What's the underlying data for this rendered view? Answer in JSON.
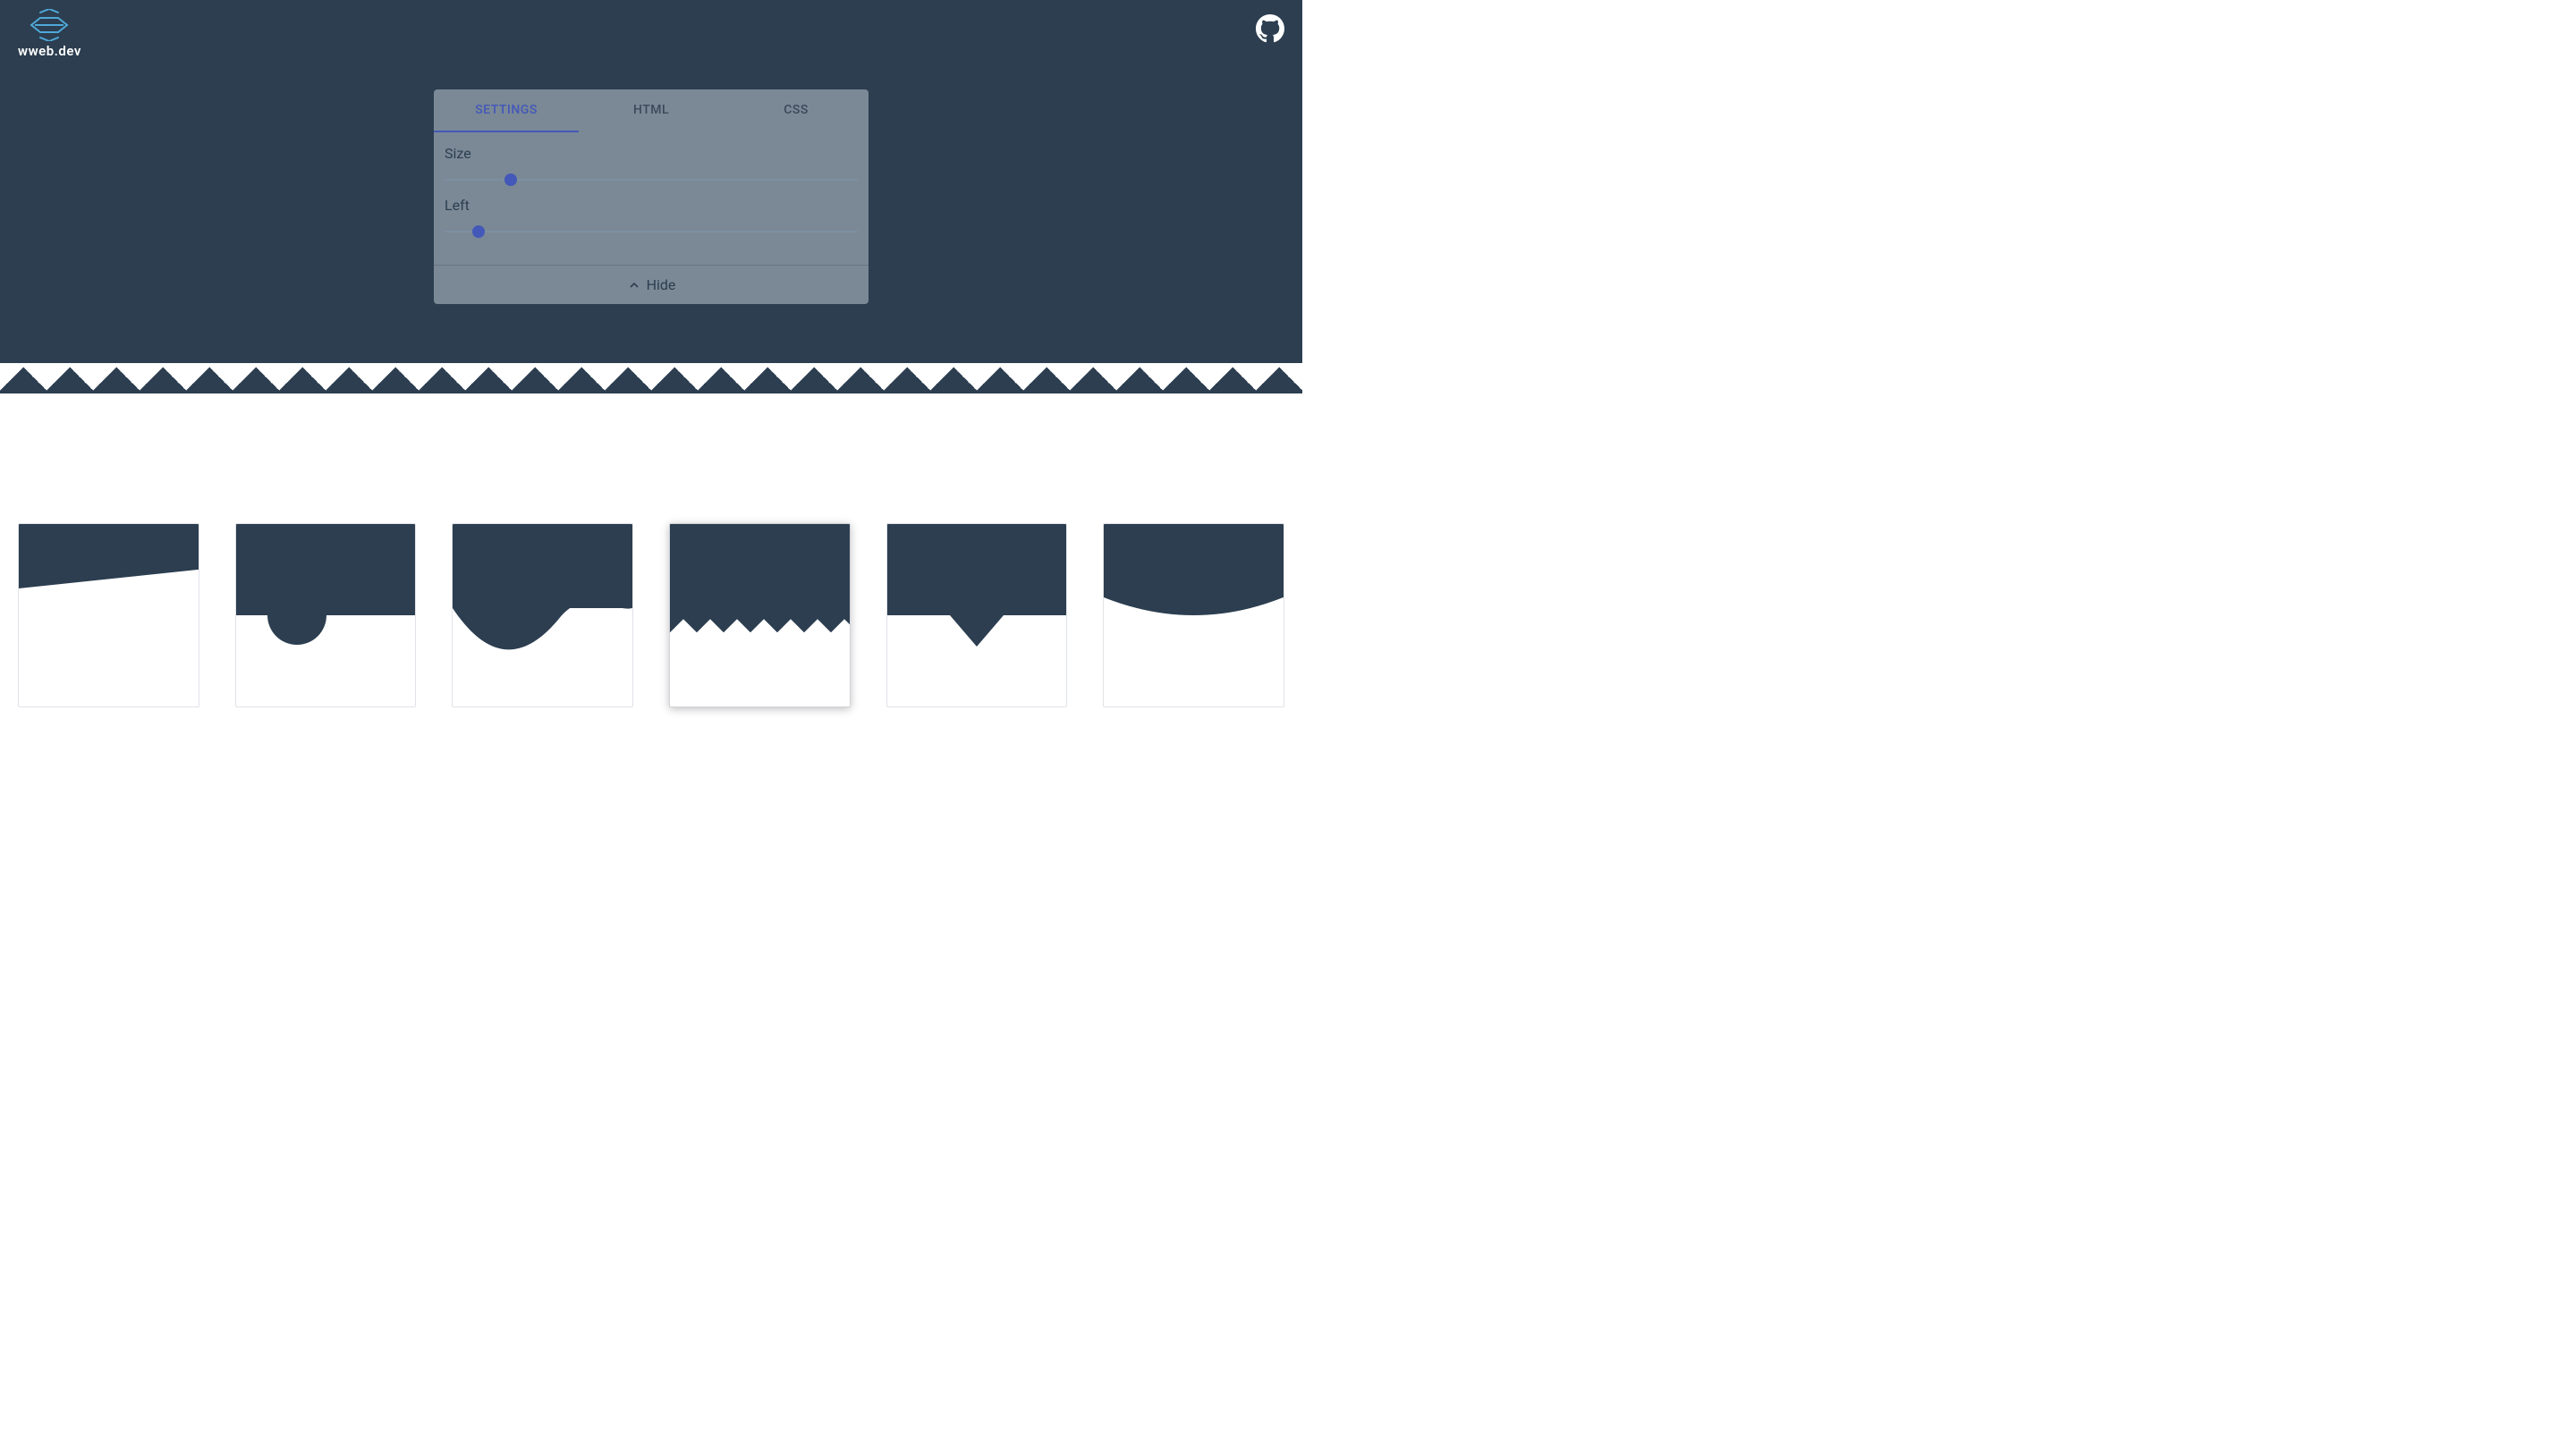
{
  "brand": {
    "name": "wweb.dev"
  },
  "panel": {
    "tabs": {
      "settings": "SETTINGS",
      "html": "HTML",
      "css": "CSS"
    },
    "controls": {
      "size": {
        "label": "Size",
        "value": 15
      },
      "left": {
        "label": "Left",
        "value": 7
      }
    },
    "hide_label": "Hide"
  },
  "gallery": {
    "items": [
      {
        "name": "diagonal"
      },
      {
        "name": "semicircle"
      },
      {
        "name": "wave"
      },
      {
        "name": "zigzag",
        "selected": true
      },
      {
        "name": "triangle"
      },
      {
        "name": "curve"
      }
    ]
  },
  "colors": {
    "primary": "#2c3e50",
    "accent": "#4358b8"
  }
}
